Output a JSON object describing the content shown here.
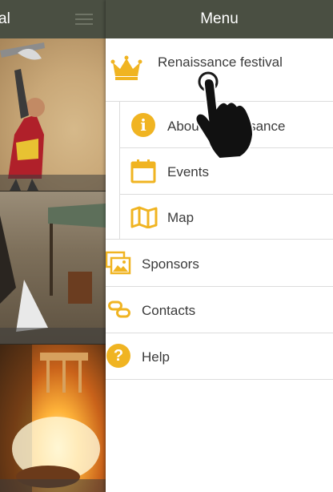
{
  "background_app": {
    "title": "al"
  },
  "drawer": {
    "title": "Menu",
    "items": [
      {
        "label": "Renaissance festival",
        "icon": "crown-icon"
      },
      {
        "label": "About Renaissance",
        "icon": "info-icon"
      },
      {
        "label": "Events",
        "icon": "calendar-icon"
      },
      {
        "label": "Map",
        "icon": "map-icon"
      },
      {
        "label": "Sponsors",
        "icon": "pictures-icon"
      },
      {
        "label": "Contacts",
        "icon": "link-icon"
      },
      {
        "label": "Help",
        "icon": "help-icon"
      }
    ]
  },
  "colors": {
    "header": "#4a4f42",
    "accent": "#f0b422",
    "text": "#3b3b3b"
  },
  "overlay": {
    "cursor": "tap-hand-icon"
  }
}
